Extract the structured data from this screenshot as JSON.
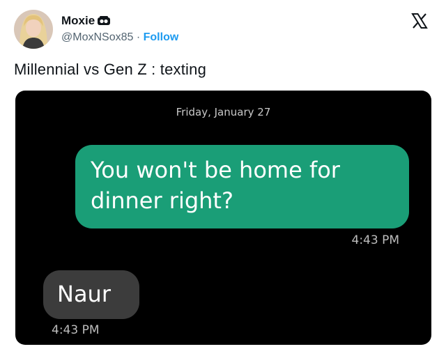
{
  "user": {
    "display_name": "Moxie",
    "badge_icon": "affiliate-badge-icon",
    "handle": "@MoxNSox85",
    "separator": "·",
    "follow_label": "Follow",
    "avatar_icon": "user-avatar"
  },
  "brand": {
    "logo_icon": "x-logo-icon"
  },
  "tweet": {
    "text": "Millennial vs Gen Z : texting"
  },
  "conversation": {
    "date": "Friday, January 27",
    "messages": [
      {
        "direction": "sent",
        "text_line1": "You won't be home for",
        "text_line2": "dinner right?",
        "time": "4:43 PM"
      },
      {
        "direction": "received",
        "text": "Naur",
        "time": "4:43 PM"
      }
    ]
  },
  "colors": {
    "follow": "#1d9bf0",
    "sent_bubble": "#1a9e77",
    "received_bubble": "#3c3c3c",
    "media_background": "#000000"
  }
}
